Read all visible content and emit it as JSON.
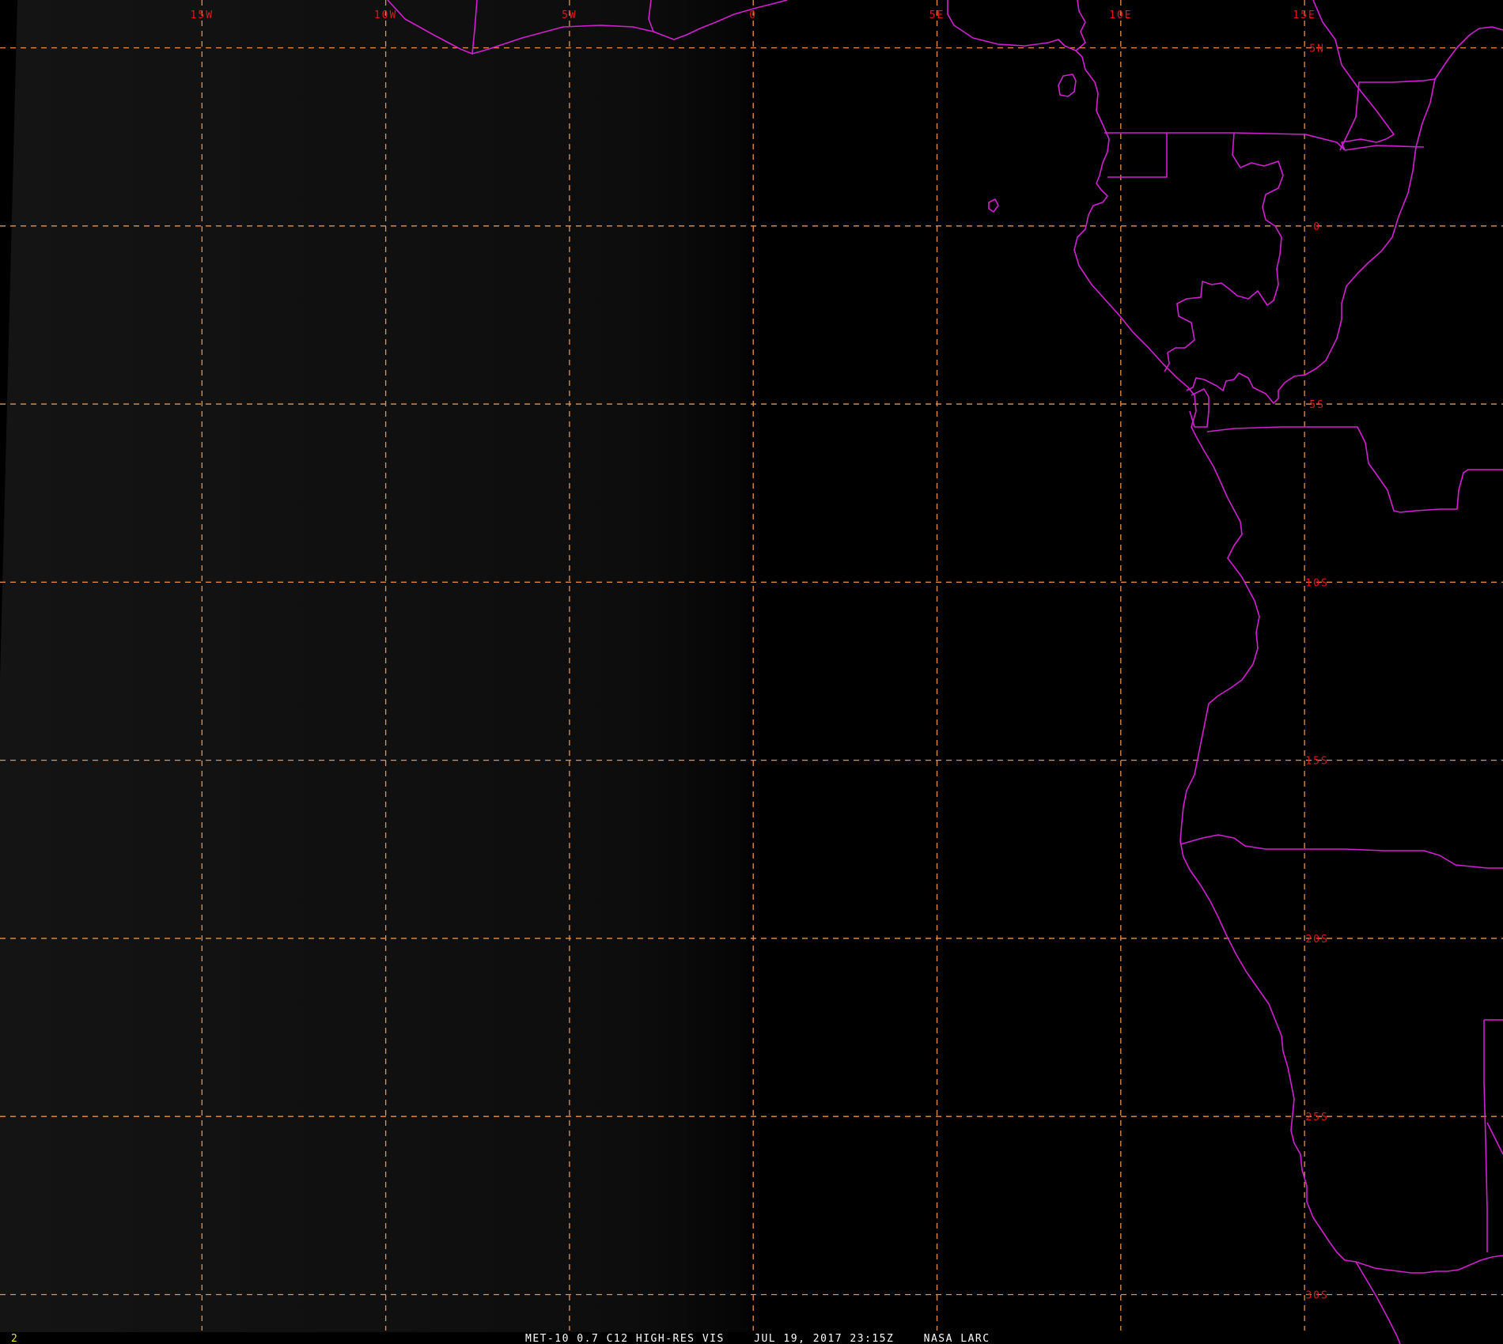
{
  "image": {
    "satellite": "MET-10",
    "channel_wavelength": "0.7",
    "channel_id": "C12",
    "product": "HIGH-RES VIS",
    "date": "JUL 19, 2017",
    "time": "23:15Z",
    "source": "NASA LARC",
    "caption": "MET-10 0.7 C12 HIGH-RES VIS    JUL 19, 2017 23:15Z    NASA LARC",
    "frame_number": "2"
  },
  "map": {
    "projection_extent": {
      "lon_min": -20,
      "lon_max": 20.4,
      "lat_min": -30.5,
      "lat_max": 5.5
    },
    "longitude_labels": [
      {
        "lon": -15,
        "text": "15W"
      },
      {
        "lon": -10,
        "text": "10W"
      },
      {
        "lon": -5,
        "text": "5W"
      },
      {
        "lon": 0,
        "text": "0"
      },
      {
        "lon": 5,
        "text": "5E"
      },
      {
        "lon": 10,
        "text": "10E"
      },
      {
        "lon": 15,
        "text": "15E"
      }
    ],
    "latitude_labels": [
      {
        "lat": 5,
        "text": "5N"
      },
      {
        "lat": 0,
        "text": "0"
      },
      {
        "lat": -5,
        "text": "5S"
      },
      {
        "lat": -10,
        "text": "10S"
      },
      {
        "lat": -15,
        "text": "15S"
      },
      {
        "lat": -20,
        "text": "20S"
      },
      {
        "lat": -25,
        "text": "25S"
      },
      {
        "lat": -30,
        "text": "30S"
      }
    ],
    "colors": {
      "background": "#000000",
      "sunlit_shade": "#141414",
      "gridlines": "#e8924a",
      "grid_labels": "#e01818",
      "coastlines_borders": "#d21fd2",
      "caption_text": "#ffffff",
      "frame_number_text": "#e8e818"
    }
  }
}
